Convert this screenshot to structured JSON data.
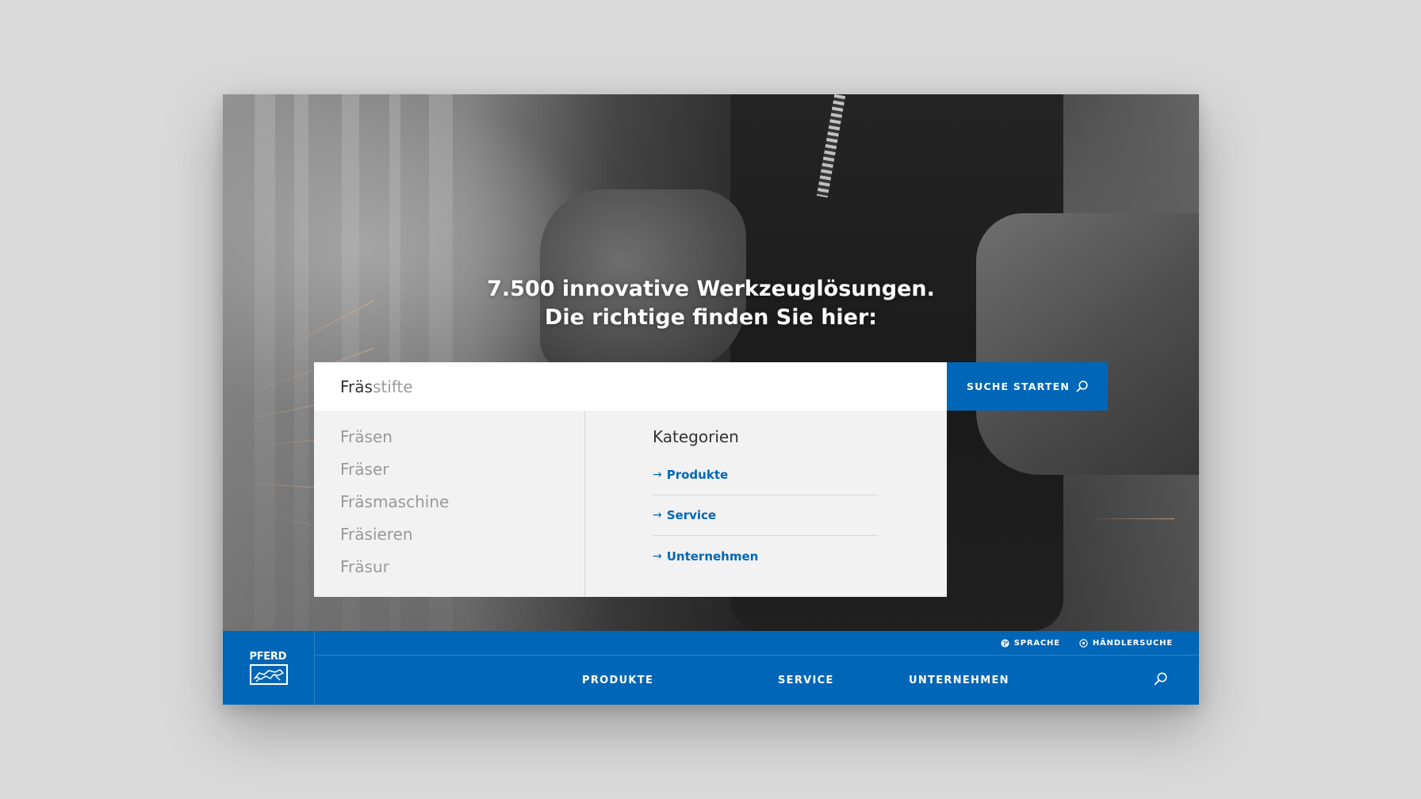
{
  "hero": {
    "headline_line1": "7.500 innovative Werkzeuglösungen.",
    "headline_line2": "Die richtige finden Sie hier:"
  },
  "search": {
    "typed": "Fräs",
    "completion": "stifte",
    "button_label": "SUCHE STARTEN"
  },
  "suggestions": [
    "Fräsen",
    "Fräser",
    "Fräsmaschine",
    "Fräsieren",
    "Fräsur"
  ],
  "categories": {
    "title": "Kategorien",
    "links": [
      "Produkte",
      "Service",
      "Unternehmen"
    ]
  },
  "header": {
    "logo": "PFERD",
    "top_links": [
      "SPRACHE",
      "HÄNDLERSUCHE"
    ],
    "nav": [
      "PRODUKTE",
      "SERVICE",
      "UNTERNEHMEN"
    ]
  },
  "colors": {
    "brand_blue": "#0067b8",
    "dropdown_bg": "#f2f2f2",
    "page_bg": "#dadada"
  }
}
